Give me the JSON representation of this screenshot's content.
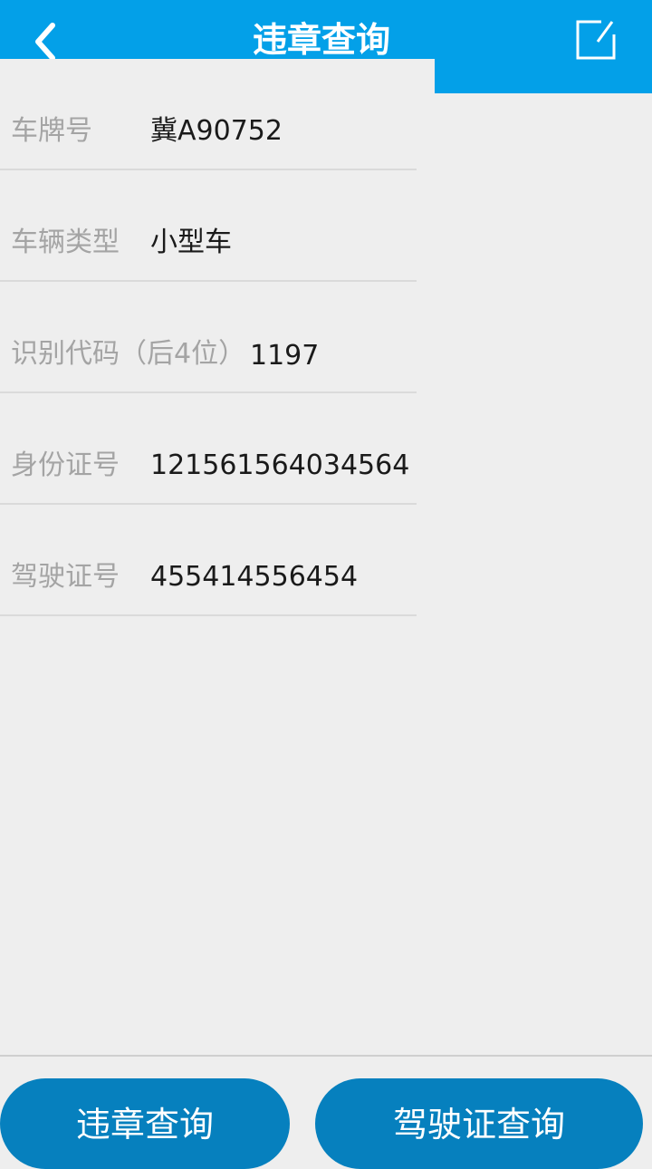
{
  "header": {
    "title": "违章查询",
    "back_icon": "chevron-left-icon",
    "edit_icon": "edit-icon",
    "color": "#03a0e8"
  },
  "form": {
    "rows": [
      {
        "label": "车牌号",
        "value": "冀A90752"
      },
      {
        "label": "车辆类型",
        "value": "小型车"
      },
      {
        "label": "识别代码（后4位）",
        "value": "1197"
      },
      {
        "label": "身份证号",
        "value": "121561564034564"
      },
      {
        "label": "驾驶证号",
        "value": "455414556454"
      }
    ]
  },
  "actions": {
    "violation_query": "违章查询",
    "license_query": "驾驶证查询",
    "button_color": "#0680be"
  }
}
